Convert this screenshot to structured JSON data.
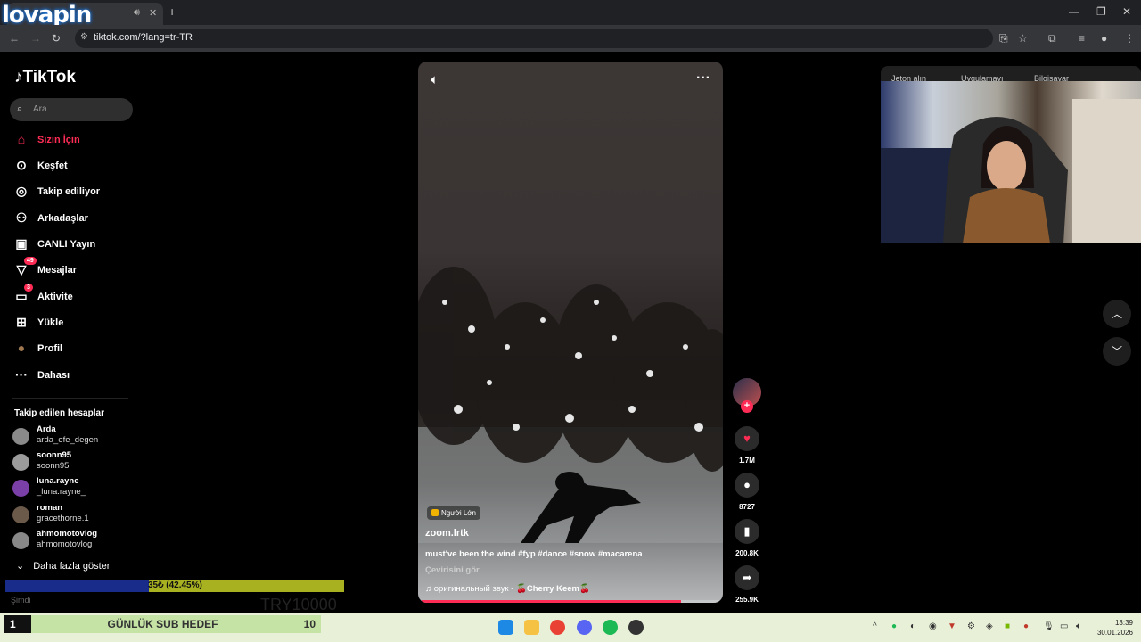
{
  "browser": {
    "url": "tiktok.com/?lang=tr-TR",
    "new_tab_icon": "+",
    "overlay_logo": "lovapin"
  },
  "sidebar": {
    "logo": "TikTok",
    "search_placeholder": "Ara",
    "nav": [
      {
        "label": "Sizin İçin",
        "icon": "home-icon",
        "active": true
      },
      {
        "label": "Keşfet",
        "icon": "compass-icon"
      },
      {
        "label": "Takip ediliyor",
        "icon": "following-icon"
      },
      {
        "label": "Arkadaşlar",
        "icon": "friends-icon"
      },
      {
        "label": "CANLI Yayın",
        "icon": "live-icon"
      },
      {
        "label": "Mesajlar",
        "icon": "messages-icon",
        "badge": "49"
      },
      {
        "label": "Aktivite",
        "icon": "activity-icon",
        "badge": "3"
      },
      {
        "label": "Yükle",
        "icon": "upload-icon"
      },
      {
        "label": "Profil",
        "icon": "profile-icon"
      },
      {
        "label": "Dahası",
        "icon": "more-icon"
      }
    ],
    "following_title": "Takip edilen hesaplar",
    "accounts": [
      {
        "name": "Arda",
        "handle": "arda_efe_degen"
      },
      {
        "name": "soonn95",
        "handle": "soonn95"
      },
      {
        "name": "luna.rayne",
        "handle": "_luna.rayne_"
      },
      {
        "name": "roman",
        "handle": "gracethorne.1"
      },
      {
        "name": "ahmomotovlog",
        "handle": "ahmomotovlog"
      }
    ],
    "show_more": "Daha fazla göster"
  },
  "video": {
    "tag": "Người Lớn",
    "author": "zoom.lrtk",
    "caption": "must've been the wind #fyp #dance #snow #macarena",
    "translate": "Çevirisini gör",
    "music_prefix": "оригинальный звук -",
    "music_artist": "🍒Cherry Keem🍒",
    "progress": 0.87
  },
  "actions": {
    "likes": "1.7M",
    "comments": "8727",
    "saves": "200.8K",
    "shares": "255.9K"
  },
  "topbar": {
    "coins": "Jeton alın",
    "app": "Uygulamayı",
    "desktop": "Bilgisayar"
  },
  "overlay": {
    "progress_text": "35₺ (42.45%)",
    "progress_fraction": 0.4245,
    "faded_left": "Şimdi",
    "faded_right": "TRY10000",
    "sub_number": "1",
    "sub_label": "GÜNLÜK SUB HEDEF",
    "sub_goal": "10"
  },
  "clock": {
    "time": "13:39",
    "date": "30.01.2026"
  },
  "colors": {
    "accent": "#fe2c55",
    "overlay_bar": "#a8b221",
    "overlay_fill": "#1a2c8a"
  }
}
